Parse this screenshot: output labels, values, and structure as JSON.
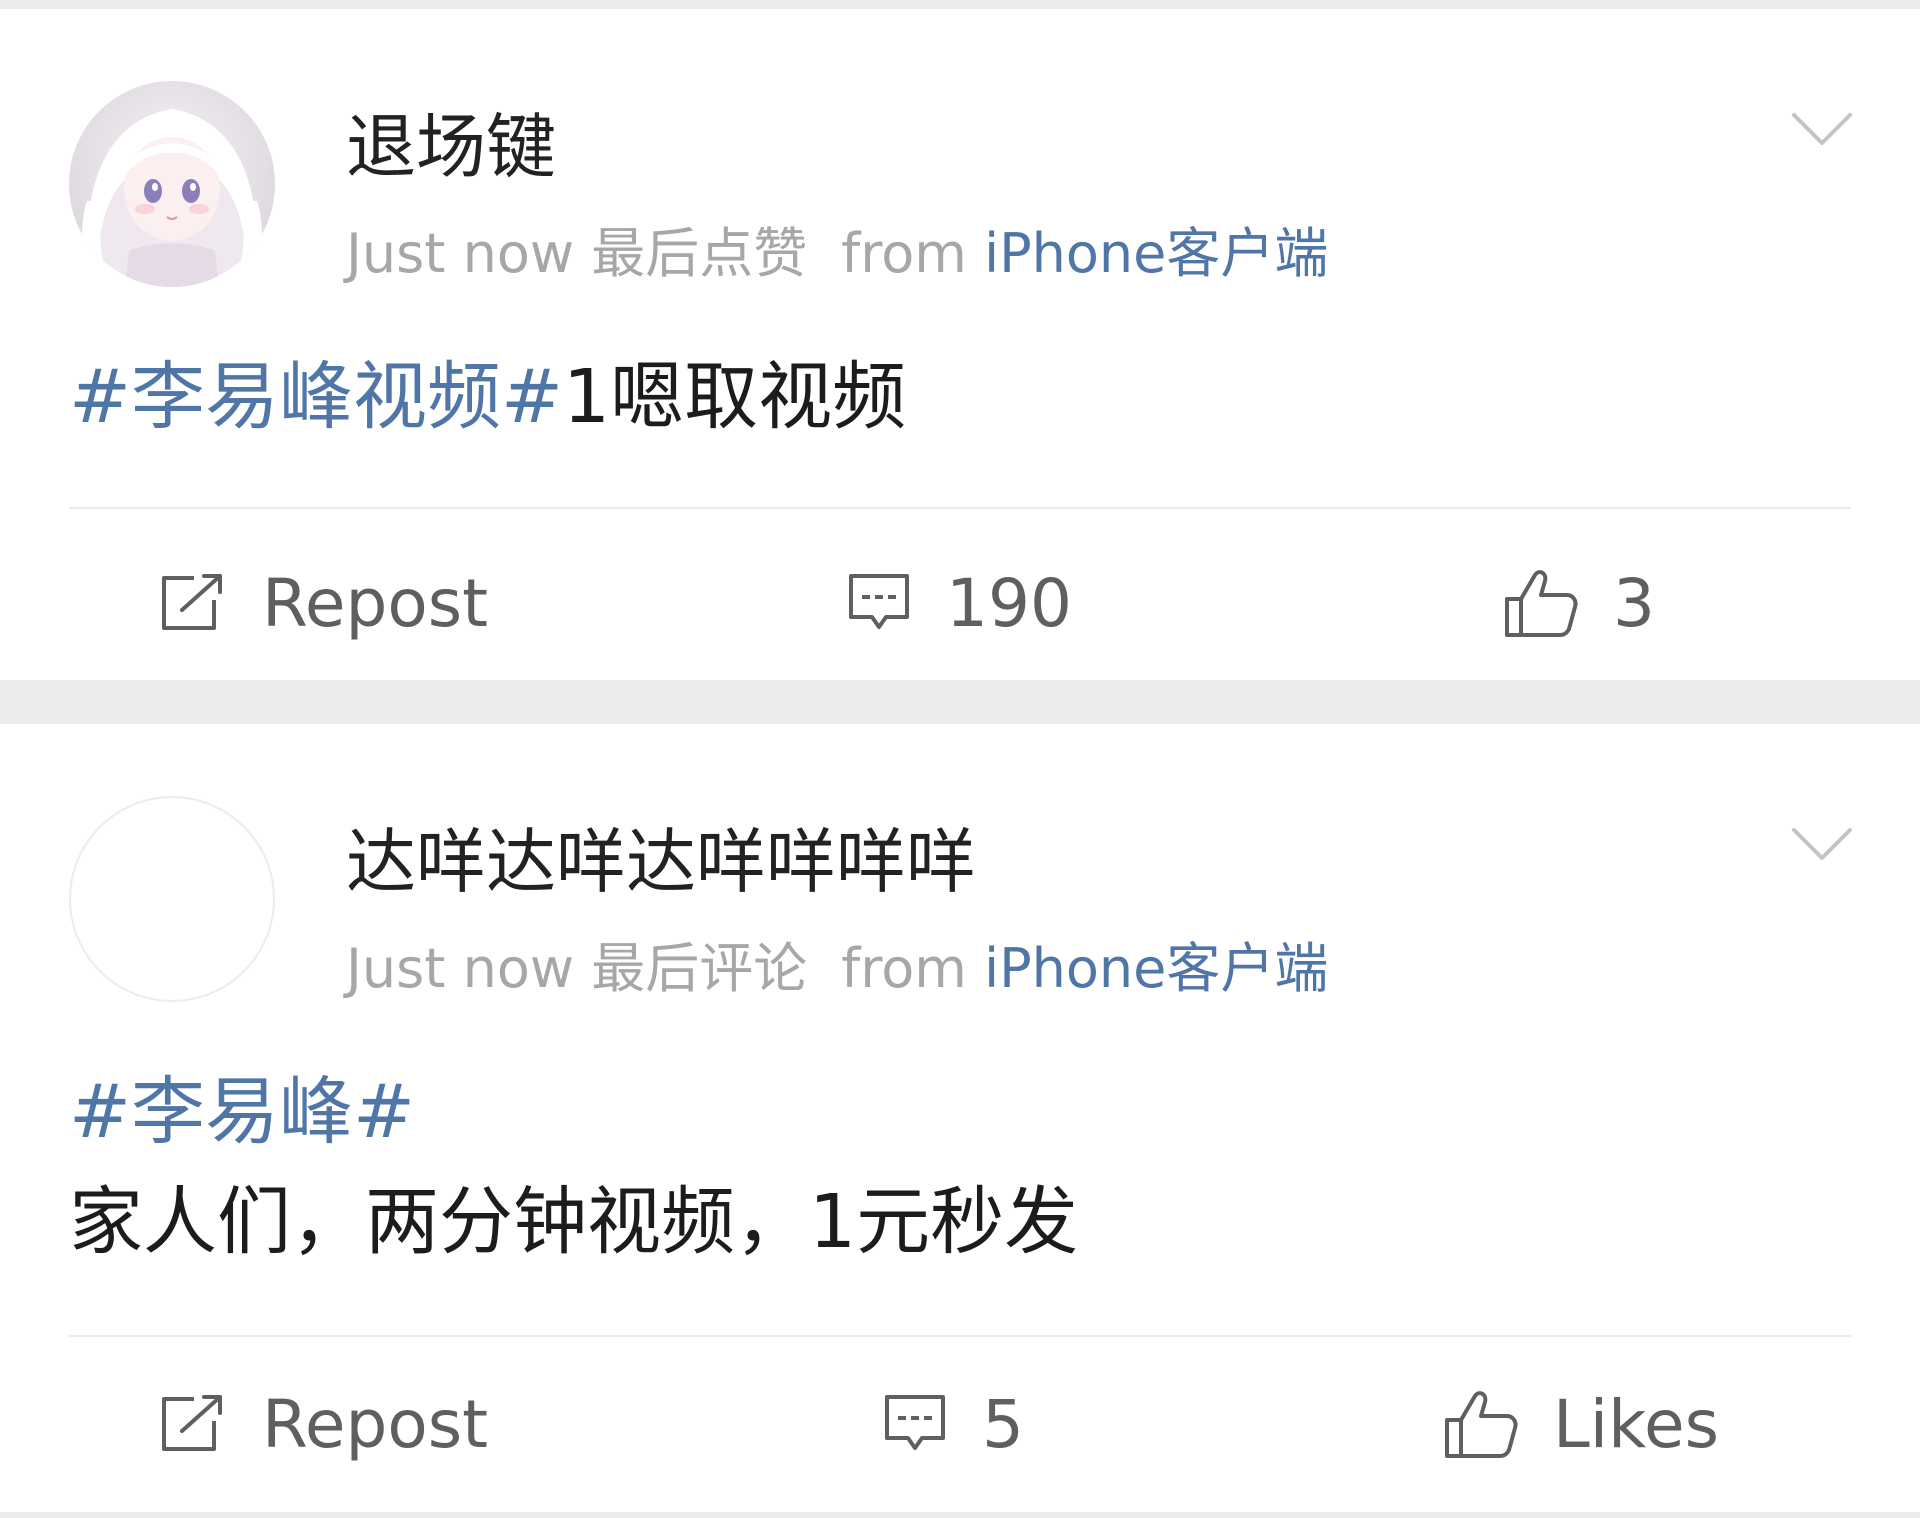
{
  "posts": [
    {
      "username": "退场键",
      "time": "Just now",
      "activity": "最后点赞",
      "source_prefix": "from",
      "source": "iPhone客户端",
      "hashtag": "#李易峰视频#",
      "text": "1嗯取视频",
      "actions": {
        "repost_label": "Repost",
        "comment_count": "190",
        "like_label": "3"
      }
    },
    {
      "username": "达咩达咩达咩咩咩咩",
      "time": "Just now",
      "activity": "最后评论",
      "source_prefix": "from",
      "source": "iPhone客户端",
      "hashtag": "#李易峰#",
      "text": "家人们，两分钟视频，1元秒发",
      "actions": {
        "repost_label": "Repost",
        "comment_count": "5",
        "like_label": "Likes"
      }
    }
  ],
  "icons": {
    "chevron": "chevron-down-icon",
    "repost": "repost-icon",
    "comment": "comment-icon",
    "like": "thumbs-up-icon"
  },
  "colors": {
    "link": "#4f76a6",
    "meta": "#a7a7a7",
    "text": "#1c1c1c",
    "background": "#ececee"
  }
}
